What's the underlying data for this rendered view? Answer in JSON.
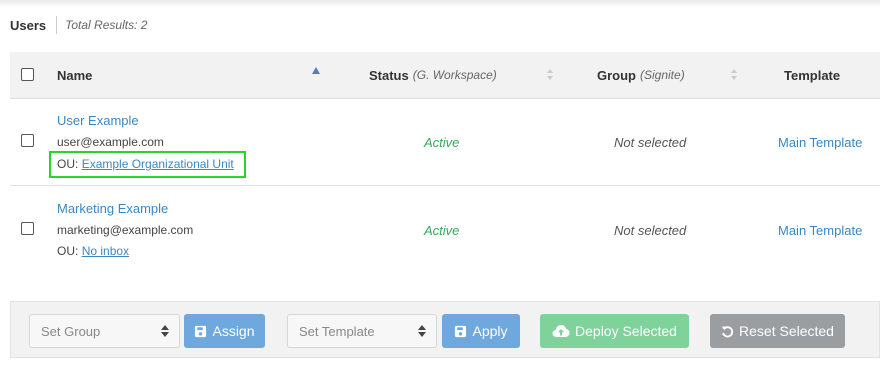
{
  "header": {
    "title": "Users",
    "total_results": "Total Results: 2"
  },
  "table": {
    "columns": {
      "name": "Name",
      "status": "Status",
      "status_sub": "(G. Workspace)",
      "group": "Group",
      "group_sub": "(Signite)",
      "template": "Template"
    },
    "rows": [
      {
        "name": "User Example",
        "email": "user@example.com",
        "ou_label": "OU:",
        "ou_value": "Example Organizational Unit",
        "status": "Active",
        "group": "Not selected",
        "template": "Main Template"
      },
      {
        "name": "Marketing Example",
        "email": "marketing@example.com",
        "ou_label": "OU:",
        "ou_value": "No inbox",
        "status": "Active",
        "group": "Not selected",
        "template": "Main Template"
      }
    ]
  },
  "footer": {
    "set_group_placeholder": "Set Group",
    "assign_label": "Assign",
    "set_template_placeholder": "Set Template",
    "apply_label": "Apply",
    "deploy_label": "Deploy Selected",
    "reset_label": "Reset Selected"
  },
  "colors": {
    "link": "#3a87c4",
    "active": "#37a85b",
    "highlight": "#2bd42b",
    "primary_button": "#6fa8dc",
    "deploy_button": "#7ed29a",
    "reset_button": "#9b9ea1"
  },
  "icons": {
    "assign": "save-icon",
    "apply": "save-icon",
    "deploy": "cloud-upload-icon",
    "reset": "undo-icon",
    "sort_name": "sort-ascending-icon",
    "sort_other": "sort-icon"
  }
}
